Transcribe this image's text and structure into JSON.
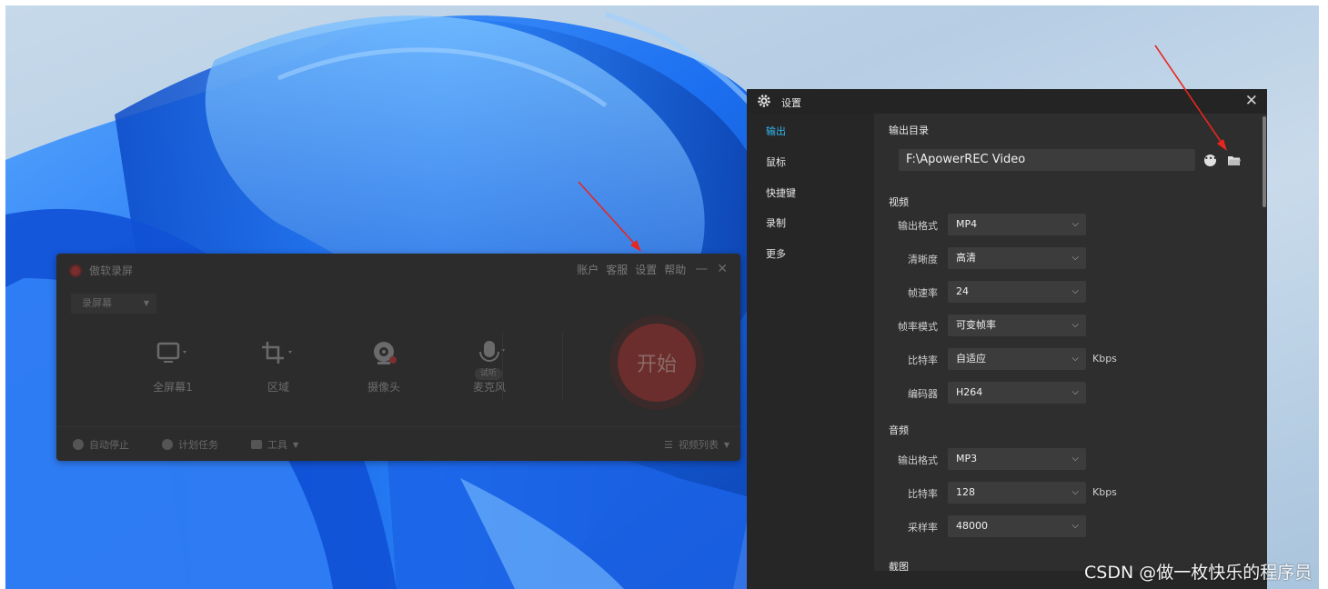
{
  "recorder": {
    "title": "傲软录屏",
    "menu": [
      "账户",
      "客服",
      "设置",
      "帮助"
    ],
    "minimize": "—",
    "close": "✕",
    "mode": "录屏幕",
    "tools": [
      {
        "label": "全屏幕1",
        "icon": "monitor-icon"
      },
      {
        "label": "区域",
        "icon": "crop-icon"
      },
      {
        "label": "摄像头",
        "icon": "webcam-icon"
      },
      {
        "label": "麦克风",
        "icon": "microphone-icon",
        "badge": "试听"
      }
    ],
    "start": "开始",
    "bottom": {
      "auto_stop": "自动停止",
      "schedule": "计划任务",
      "tools": "工具",
      "video_list": "视频列表"
    }
  },
  "settings": {
    "title": "设置",
    "close": "✕",
    "nav": [
      "输出",
      "鼠标",
      "快捷键",
      "录制",
      "更多"
    ],
    "active_nav": 0,
    "output_dir_label": "输出目录",
    "output_dir": "F:\\ApowerREC Video",
    "more_button": "•••",
    "video_label": "视频",
    "video": [
      {
        "label": "输出格式",
        "value": "MP4"
      },
      {
        "label": "清晰度",
        "value": "高清"
      },
      {
        "label": "帧速率",
        "value": "24"
      },
      {
        "label": "帧率模式",
        "value": "可变帧率"
      },
      {
        "label": "比特率",
        "value": "自适应",
        "unit": "Kbps"
      },
      {
        "label": "编码器",
        "value": "H264"
      }
    ],
    "audio_label": "音频",
    "audio": [
      {
        "label": "输出格式",
        "value": "MP3"
      },
      {
        "label": "比特率",
        "value": "128",
        "unit": "Kbps"
      },
      {
        "label": "采样率",
        "value": "48000"
      }
    ],
    "screenshot_label": "截图"
  },
  "watermark": "CSDN @做一枚快乐的程序员",
  "colors": {
    "accent": "#33b4f0",
    "arrow": "#e8261f",
    "wallpaper_blue": "#1e6fe8"
  }
}
